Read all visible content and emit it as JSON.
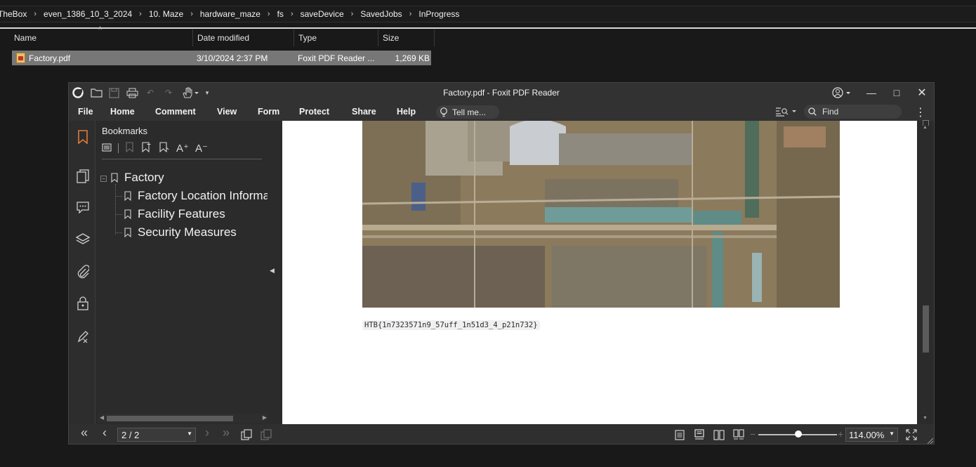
{
  "explorer": {
    "breadcrumbs": [
      "kTheBox",
      "even_1386_10_3_2024",
      "10. Maze",
      "hardware_maze",
      "fs",
      "saveDevice",
      "SavedJobs",
      "InProgress"
    ],
    "columns": {
      "name": "Name",
      "date": "Date modified",
      "type": "Type",
      "size": "Size"
    },
    "files": [
      {
        "name": "Factory.pdf",
        "date": "3/10/2024 2:37 PM",
        "type": "Foxit PDF Reader ...",
        "size": "1,269 KB"
      }
    ]
  },
  "reader": {
    "title": "Factory.pdf - Foxit PDF Reader",
    "menu": [
      "File",
      "Home",
      "Comment",
      "View",
      "Form",
      "Protect",
      "Share",
      "Help"
    ],
    "tell_me": "Tell me...",
    "find_placeholder": "Find",
    "bookmarks": {
      "title": "Bookmarks",
      "root": "Factory",
      "children": [
        "Factory Location Information",
        "Facility Features",
        "Security Measures"
      ]
    },
    "document": {
      "flag_text": "HTB{1n7323571n9_57uff_1n51d3_4_p21n732}"
    },
    "status": {
      "page": "2 / 2",
      "zoom": "114.00%",
      "zoom_level_percent": 114
    },
    "colors": {
      "accent": "#e07b39",
      "selected_row": "#777777",
      "window_bg": "#2b2b2b"
    }
  }
}
